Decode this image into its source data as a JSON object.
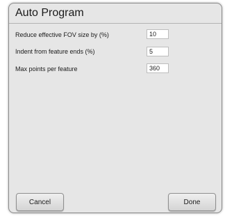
{
  "dialog": {
    "title": "Auto Program",
    "settings": [
      {
        "label": "Reduce effective FOV size by (%)",
        "value": "10"
      },
      {
        "label": "Indent from feature ends (%)",
        "value": "5"
      },
      {
        "label": "Max points per feature",
        "value": "360"
      }
    ],
    "cancel_label": "Cancel",
    "done_label": "Done"
  }
}
